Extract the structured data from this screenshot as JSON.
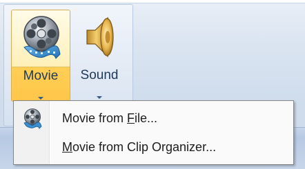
{
  "ribbon": {
    "movie_button": {
      "label": "Movie",
      "icon": "film-reel-icon"
    },
    "sound_button": {
      "label": "Sound",
      "icon": "speaker-icon"
    }
  },
  "menu": {
    "items": [
      {
        "before": "Movie from ",
        "accel": "F",
        "after": "ile...",
        "icon": "film-reel-icon"
      },
      {
        "before": "",
        "accel": "M",
        "after": "ovie from Clip Organizer...",
        "icon": ""
      }
    ]
  },
  "colors": {
    "hover_gold": "#ffd359",
    "label_blue": "#1e395b",
    "menu_bg": "#fafafa"
  }
}
